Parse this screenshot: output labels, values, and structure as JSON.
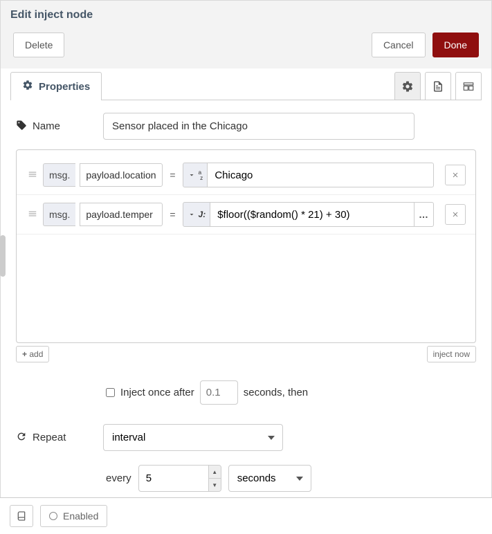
{
  "header": {
    "title": "Edit inject node"
  },
  "actions": {
    "delete": "Delete",
    "cancel": "Cancel",
    "done": "Done"
  },
  "tabs": {
    "properties": "Properties"
  },
  "name": {
    "label": "Name",
    "value": "Sensor placed in the Chicago"
  },
  "props": [
    {
      "prefix": "msg.",
      "path": "payload.location",
      "type": "str",
      "type_icon": "a_z",
      "value": "Chicago"
    },
    {
      "prefix": "msg.",
      "path": "payload.temper",
      "type": "jsonata",
      "type_icon": "J:",
      "value": "$floor(($random() * 21) + 30)"
    }
  ],
  "add_btn": "add",
  "inject_now": "inject now",
  "inject_once": {
    "label_before": "Inject once after",
    "delay_placeholder": "0.1",
    "label_after": "seconds, then"
  },
  "repeat": {
    "label": "Repeat",
    "mode": "interval",
    "every_label": "every",
    "every_value": "5",
    "unit": "seconds"
  },
  "footer": {
    "enabled": "Enabled"
  },
  "eq": "="
}
